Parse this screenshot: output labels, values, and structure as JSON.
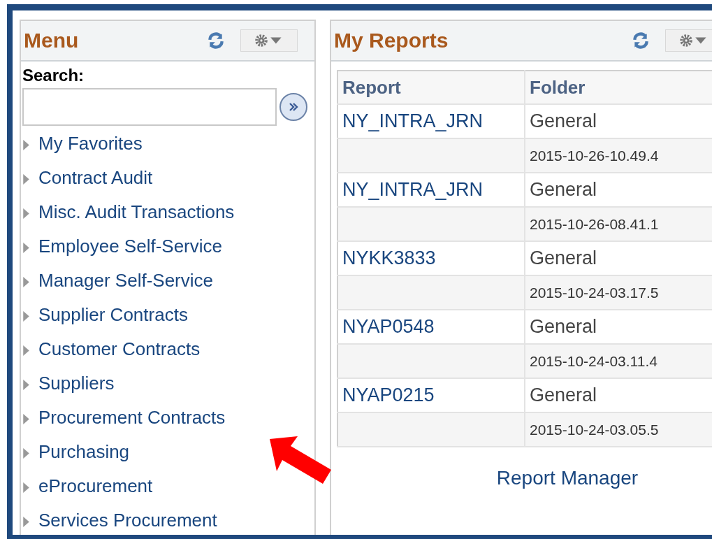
{
  "menu": {
    "title": "Menu",
    "search_label": "Search:",
    "items": [
      {
        "label": "My Favorites"
      },
      {
        "label": "Contract Audit"
      },
      {
        "label": "Misc. Audit Transactions"
      },
      {
        "label": "Employee Self-Service"
      },
      {
        "label": "Manager Self-Service"
      },
      {
        "label": "Supplier Contracts"
      },
      {
        "label": "Customer Contracts"
      },
      {
        "label": "Suppliers"
      },
      {
        "label": "Procurement Contracts"
      },
      {
        "label": "Purchasing"
      },
      {
        "label": "eProcurement"
      },
      {
        "label": "Services Procurement"
      }
    ]
  },
  "reports": {
    "title": "My Reports",
    "columns": [
      "Report",
      "Folder"
    ],
    "rows": [
      {
        "report": "NY_INTRA_JRN",
        "folder": "General",
        "date": "2015-10-26-10.49.4"
      },
      {
        "report": "NY_INTRA_JRN",
        "folder": "General",
        "date": "2015-10-26-08.41.1"
      },
      {
        "report": "NYKK3833",
        "folder": "General",
        "date": "2015-10-24-03.17.5"
      },
      {
        "report": "NYAP0548",
        "folder": "General",
        "date": "2015-10-24-03.11.4"
      },
      {
        "report": "NYAP0215",
        "folder": "General",
        "date": "2015-10-24-03.05.5"
      }
    ],
    "link": "Report Manager"
  }
}
